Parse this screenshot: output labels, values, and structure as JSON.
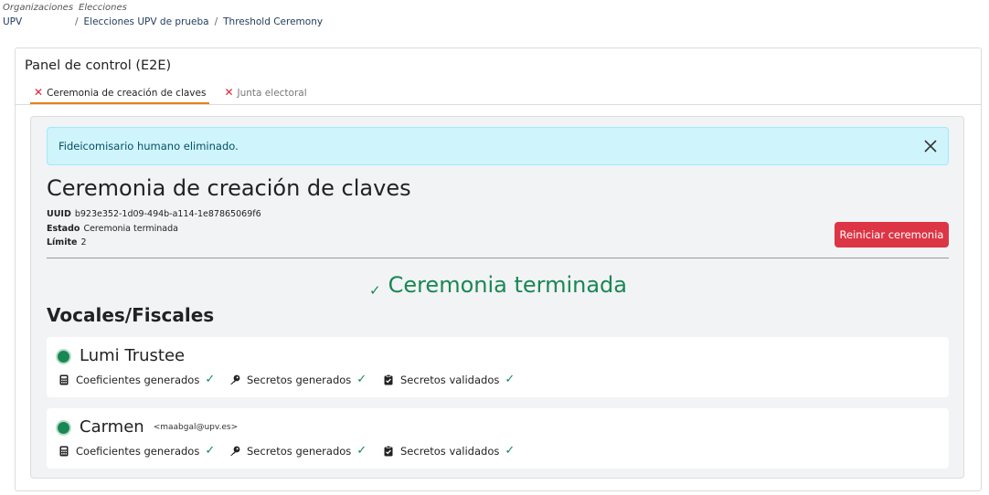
{
  "breadcrumb": {
    "org_label": "Organizaciones",
    "org_value": "UPV",
    "elections_label": "Elecciones",
    "separator": "/",
    "election": "Elecciones UPV de prueba",
    "current": "Threshold Ceremony"
  },
  "panel": {
    "title": "Panel de control (E2E)",
    "tabs": [
      {
        "label": "Ceremonia de creación de claves",
        "icon": "x-icon",
        "active": true
      },
      {
        "label": "Junta electoral",
        "icon": "x-icon",
        "active": false
      }
    ]
  },
  "alert": {
    "message": "Fideicomisario humano eliminado.",
    "close_icon": "close-icon"
  },
  "ceremony": {
    "title": "Ceremonia de creación de claves",
    "uuid_label": "UUID",
    "uuid": "b923e352-1d09-494b-a114-1e87865069f6",
    "state_label": "Estado",
    "state": "Ceremonia terminada",
    "limit_label": "Límite",
    "limit": "2",
    "restart_button": "Reiniciar ceremonia",
    "status_check": "✓",
    "status_text": "Ceremonia terminada"
  },
  "trustees_section": {
    "title": "Vocales/Fiscales",
    "trustees": [
      {
        "name": "Lumi Trustee",
        "email": "",
        "steps": [
          {
            "label": "Coeficientes generados",
            "icon": "calculator-icon",
            "check": "✓"
          },
          {
            "label": "Secretos generados",
            "icon": "key-icon",
            "check": "✓"
          },
          {
            "label": "Secretos validados",
            "icon": "clipboard-check-icon",
            "check": "✓"
          }
        ]
      },
      {
        "name": "Carmen",
        "email": "<maabgal@upv.es>",
        "steps": [
          {
            "label": "Coeficientes generados",
            "icon": "calculator-icon",
            "check": "✓"
          },
          {
            "label": "Secretos generados",
            "icon": "key-icon",
            "check": "✓"
          },
          {
            "label": "Secretos validados",
            "icon": "clipboard-check-icon",
            "check": "✓"
          }
        ]
      }
    ]
  },
  "colors": {
    "success": "#198754",
    "danger": "#dc3545",
    "alert_bg": "#cff4fc",
    "tab_accent": "#e87f1a"
  }
}
